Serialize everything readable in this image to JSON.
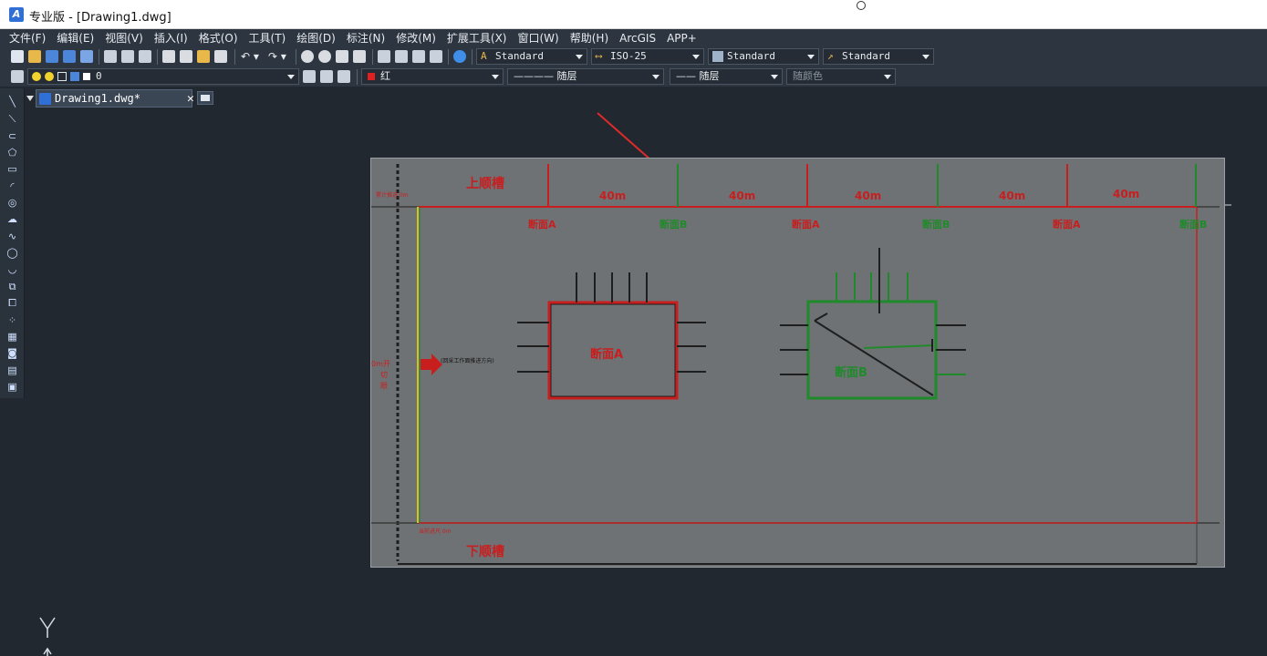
{
  "titlebar": {
    "title": "专业版 - [Drawing1.dwg]"
  },
  "menu": [
    "文件(F)",
    "编辑(E)",
    "视图(V)",
    "插入(I)",
    "格式(O)",
    "工具(T)",
    "绘图(D)",
    "标注(N)",
    "修改(M)",
    "扩展工具(X)",
    "窗口(W)",
    "帮助(H)",
    "ArcGIS",
    "APP+"
  ],
  "styles_toolbar": {
    "text_style": "Standard",
    "dim_style": "ISO-25",
    "table_style": "Standard",
    "multileader_style": "Standard"
  },
  "layer_toolbar": {
    "layer": "0",
    "color": "红",
    "linetype": "———— 随层",
    "lineweight": "—— 随层",
    "plot_style": "随颜色"
  },
  "tab": {
    "label": "Drawing1.dwg*",
    "close": "✕"
  },
  "drawing": {
    "top_label": "上顺槽",
    "bottom_label": "下顺槽",
    "top_small_label": "累计推进 0m",
    "bottom_small_label": "当前进尺 0m",
    "left_label_1": "0m开",
    "left_label_2": "切",
    "left_label_3": "眼",
    "arrow_label": "(回采工作面推进方向)",
    "spacing_labels": [
      "40m",
      "40m",
      "40m",
      "40m",
      "40m"
    ],
    "section_labels": [
      "断面A",
      "断面B",
      "断面A",
      "断面B",
      "断面A",
      "断面B"
    ],
    "box_a_label": "断面A",
    "box_b_label": "断面B"
  },
  "ucs": {
    "y_label": "Y"
  },
  "colors": {
    "red": "#c81e1e",
    "green": "#1f8a2a",
    "yellow": "#d4c21e",
    "background": "#212830",
    "paper": "#6f7275"
  }
}
